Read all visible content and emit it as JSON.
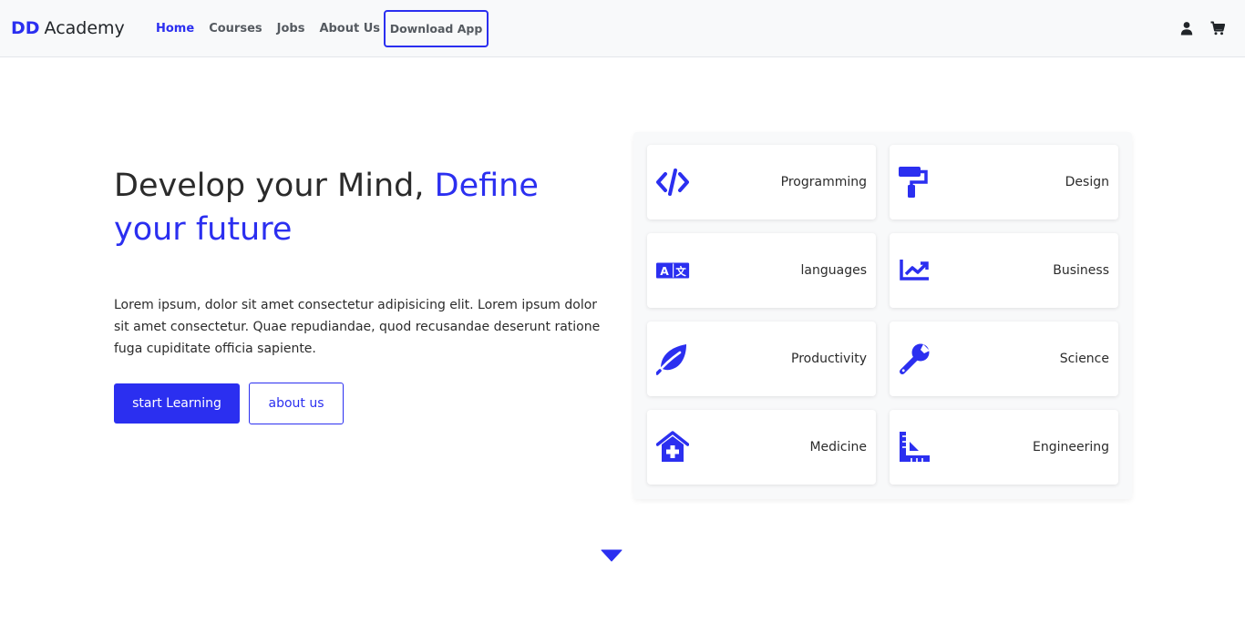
{
  "colors": {
    "accent": "#2b2ff0",
    "navbar_bg": "#f8f9fa",
    "panel_bg": "#f8f9fa",
    "text": "#2b2b2b"
  },
  "navbar": {
    "brand_short": "DD",
    "brand_name": "Academy",
    "links": [
      {
        "label": "Home",
        "active": true
      },
      {
        "label": "Courses",
        "active": false
      },
      {
        "label": "Jobs",
        "active": false
      },
      {
        "label": "About Us",
        "active": false
      }
    ],
    "download_label": "Download App",
    "icons": [
      "user-icon",
      "cart-icon"
    ]
  },
  "hero": {
    "title_plain": "Develop your Mind,",
    "title_accent": "Define your future",
    "text": "Lorem ipsum, dolor sit amet consectetur adipisicing elit. Lorem ipsum dolor sit amet consectetur. Quae repudiandae, quod recusandae deserunt ratione fuga cupiditate officia sapiente.",
    "primary_button": "start Learning",
    "secondary_button": "about us"
  },
  "categories": [
    {
      "label": "Programming",
      "icon": "code-icon"
    },
    {
      "label": "Design",
      "icon": "paint-roller-icon"
    },
    {
      "label": "languages",
      "icon": "language-icon"
    },
    {
      "label": "Business",
      "icon": "chart-line-icon"
    },
    {
      "label": "Productivity",
      "icon": "leaf-icon"
    },
    {
      "label": "Science",
      "icon": "wrench-icon"
    },
    {
      "label": "Medicine",
      "icon": "clinic-house-icon"
    },
    {
      "label": "Engineering",
      "icon": "ruler-icon"
    }
  ],
  "scroll_indicator": "caret-down-icon"
}
